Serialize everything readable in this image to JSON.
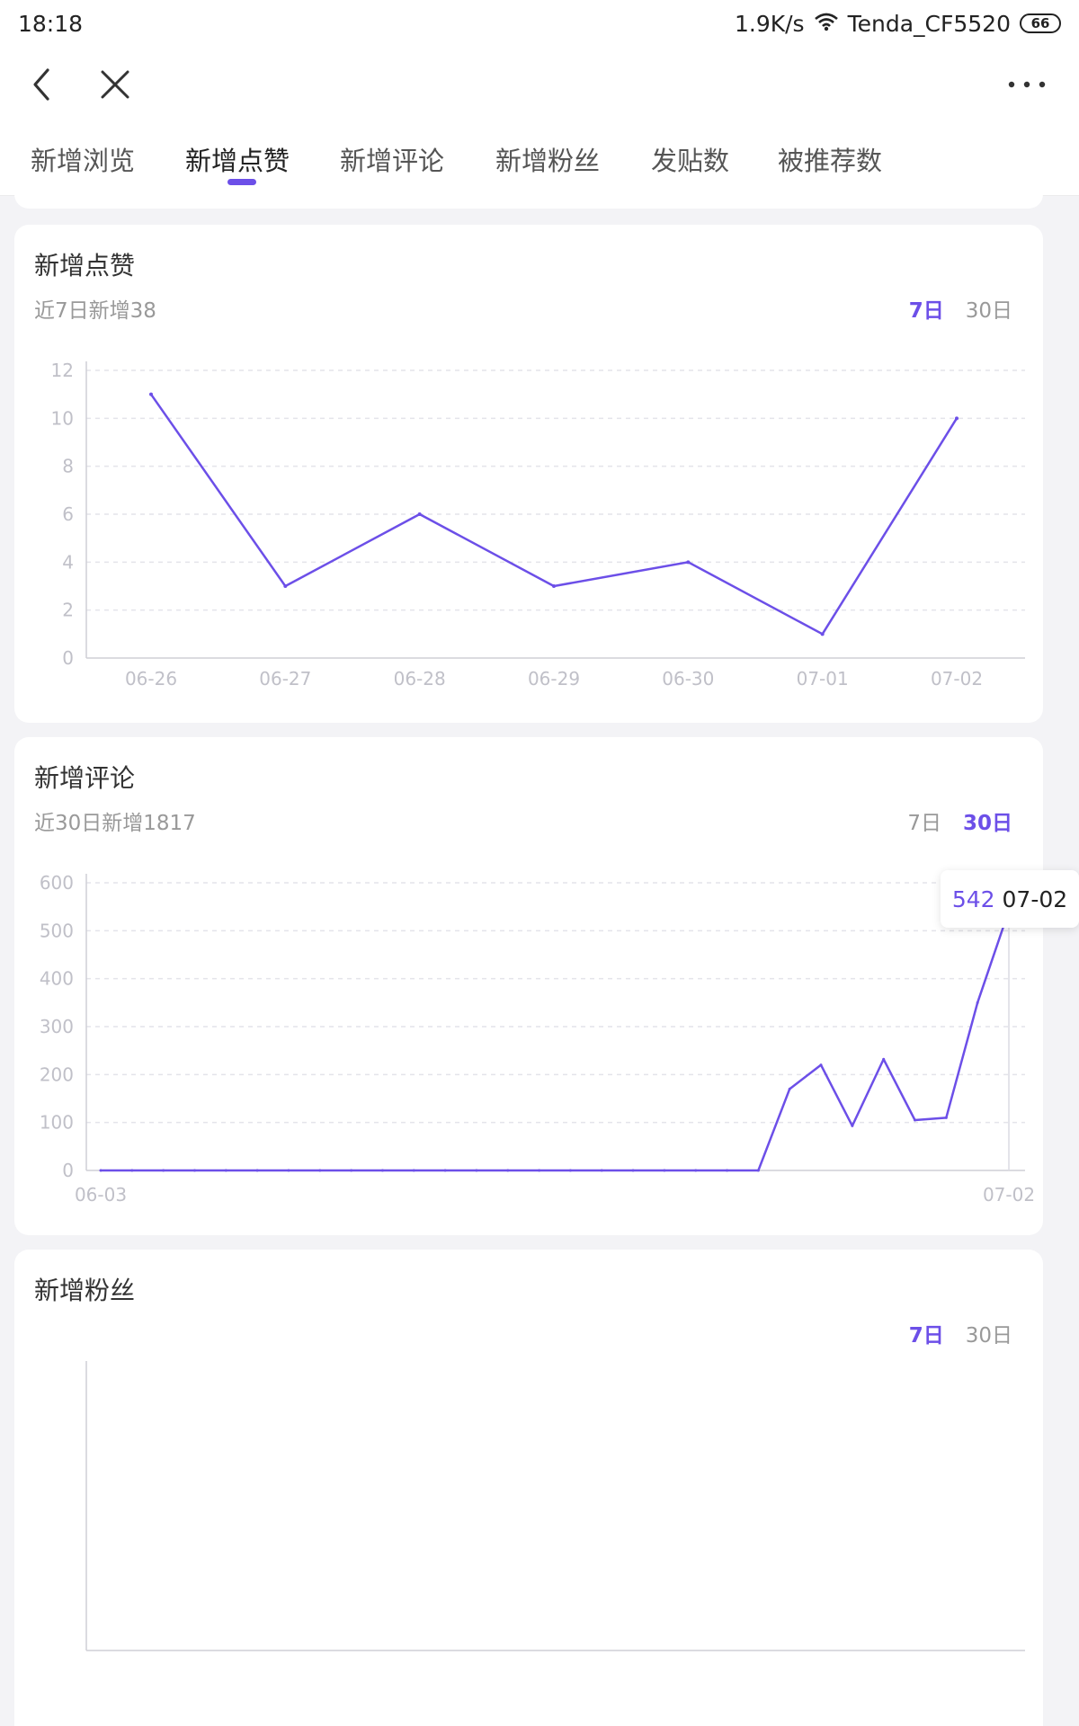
{
  "status_bar": {
    "time": "18:18",
    "net_speed": "1.9K/s",
    "wifi_name": "Tenda_CF5520",
    "battery": "66"
  },
  "tabs": [
    {
      "label": "新增浏览"
    },
    {
      "label": "新增点赞"
    },
    {
      "label": "新增评论"
    },
    {
      "label": "新增粉丝"
    },
    {
      "label": "发贴数"
    },
    {
      "label": "被推荐数"
    }
  ],
  "active_tab": "新增点赞",
  "accent_color": "#6c4fe8",
  "icons": {
    "back": "chevron-left-icon",
    "close": "close-icon",
    "more": "more-horizontal-icon",
    "wifi": "wifi-icon"
  },
  "cards": {
    "likes": {
      "title": "新增点赞",
      "subtitle": "近7日新增38",
      "range_7": "7日",
      "range_30": "30日",
      "selected_range": "7日"
    },
    "comments": {
      "title": "新增评论",
      "subtitle": "近30日新增1817",
      "range_7": "7日",
      "range_30": "30日",
      "selected_range": "30日",
      "tooltip": {
        "value": "542",
        "date": "07-02"
      }
    },
    "fans": {
      "title": "新增粉丝",
      "range_7": "7日",
      "range_30": "30日",
      "selected_range": "7日"
    }
  },
  "chart_data": [
    {
      "type": "line",
      "title": "新增点赞",
      "categories": [
        "06-26",
        "06-27",
        "06-28",
        "06-29",
        "06-30",
        "07-01",
        "07-02"
      ],
      "values": [
        11,
        3,
        6,
        3,
        4,
        1,
        10
      ],
      "yticks": [
        0,
        2,
        4,
        6,
        8,
        10,
        12
      ],
      "ylim": [
        0,
        12
      ],
      "grid": true,
      "color": "#6c4fe8"
    },
    {
      "type": "line",
      "title": "新增评论",
      "x_tick_labels": [
        "06-03",
        "07-02"
      ],
      "x_range": [
        "06-03",
        "07-02"
      ],
      "values": [
        0,
        0,
        0,
        0,
        0,
        0,
        0,
        0,
        0,
        0,
        0,
        0,
        0,
        0,
        0,
        0,
        0,
        0,
        0,
        0,
        0,
        0,
        170,
        220,
        93,
        232,
        105,
        110,
        350,
        542
      ],
      "yticks": [
        0,
        100,
        200,
        300,
        400,
        500,
        600
      ],
      "ylim": [
        0,
        600
      ],
      "grid": true,
      "highlight": {
        "x": "07-02",
        "y": 542
      },
      "color": "#6c4fe8"
    },
    {
      "type": "line",
      "title": "新增粉丝",
      "values": [],
      "grid": false
    }
  ]
}
